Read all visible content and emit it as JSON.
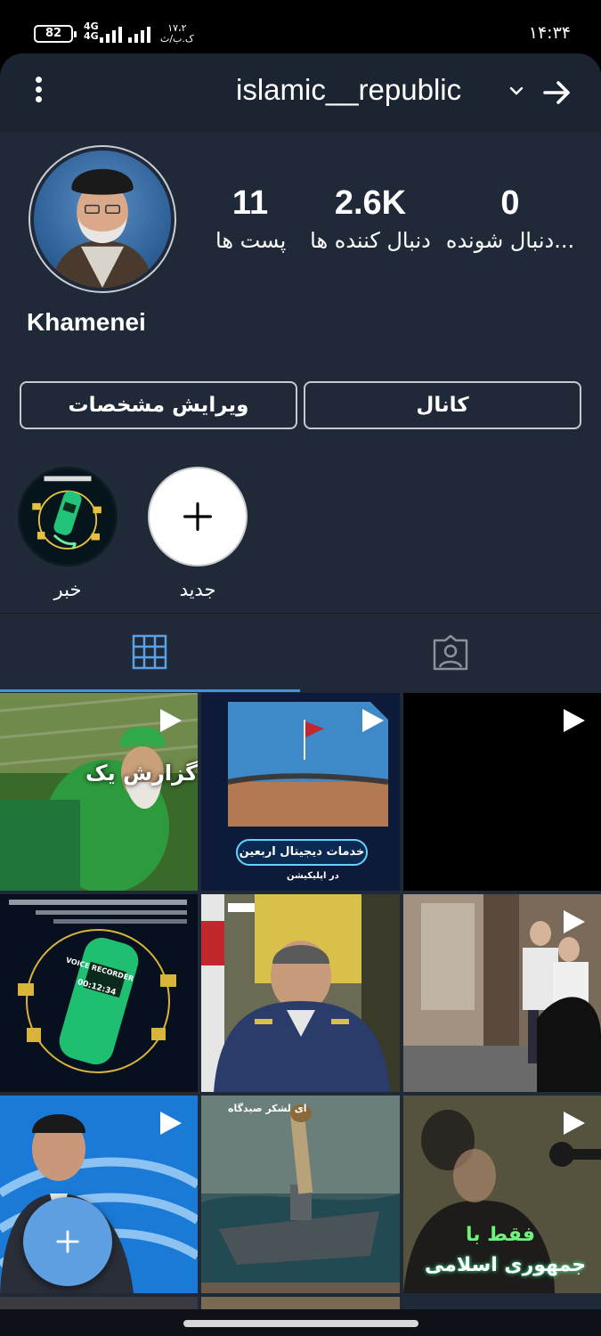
{
  "status_bar": {
    "battery": "82",
    "network": "4G",
    "network_sub": "4G",
    "speed_value": "۱۷،۲",
    "speed_unit": "ک.ب/ث",
    "time": "۱۴:۳۴"
  },
  "header": {
    "username": "islamic__republic"
  },
  "profile": {
    "name": "Khamenei",
    "stats": {
      "posts": {
        "value": "11",
        "label": "پست ها"
      },
      "followers": {
        "value": "2.6K",
        "label": "دنبال کننده ها"
      },
      "following": {
        "value": "0",
        "label": "دنبال شونده..."
      }
    },
    "buttons": {
      "edit": "ویرایش مشخصات",
      "channel": "کانال"
    }
  },
  "highlights": [
    {
      "label": "خبر"
    },
    {
      "label": "جدید"
    }
  ],
  "posts": {
    "p1_text": "گزارش یک",
    "p2_text": "خدمات دیجیتال اربعین",
    "p2_sub": "در اپلیکیشن",
    "p4_text": "VOICE RECORDER",
    "p4_time": "00:12:34",
    "p8_text": "ای لشکر صیدگاه",
    "p9_text": "جمهوری اسلامی",
    "p9_text2": "فقط با"
  },
  "colors": {
    "background": "#202938",
    "topbar": "#1b2431",
    "accent": "#4a90d9",
    "fab": "#5d9fe0"
  },
  "icons": {
    "menu": "more-vertical-icon",
    "dropdown": "chevron-down-icon",
    "back": "arrow-right-icon",
    "grid_tab": "grid-icon",
    "tagged_tab": "person-tag-icon",
    "add": "plus-icon",
    "video": "play-icon"
  }
}
